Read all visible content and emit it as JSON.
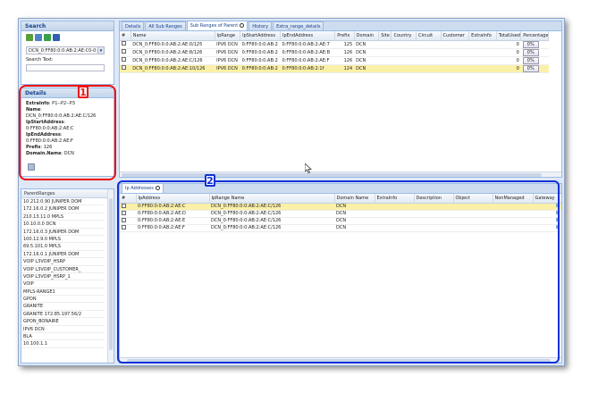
{
  "search_panel": {
    "title": "Search",
    "combo_value": "DCN_0:FF80:0:0:AB:2:AE:C0-0:F:",
    "search_text_label": "Search Text:"
  },
  "details_panel": {
    "title": "Details",
    "lines": [
      {
        "label": "ExtraInfo",
        "value": ": P1--P2--P3"
      },
      {
        "label": "Name",
        "value": ":"
      },
      {
        "label": "",
        "value": "DCN_0:FF80:0:0:AB:2:AE:C/126"
      },
      {
        "label": "IpStartAddress",
        "value": ":"
      },
      {
        "label": "",
        "value": "0:FF80:0:0:AB:2:AE:C"
      },
      {
        "label": "IpEndAddress",
        "value": ":"
      },
      {
        "label": "",
        "value": "0:FF80:0:0:AB:2:AE:F"
      },
      {
        "label": "Prefix",
        "value": ": 126"
      },
      {
        "label": "Domain.Name",
        "value": ": DCN"
      }
    ]
  },
  "parent_ranges": {
    "header": "ParentRanges",
    "items": [
      "10.212.0.90 JUNIPER DOM",
      "172.16.0.2 JUNIPER DOM",
      "210.13.11.0 MPLS",
      "10.10.0.0 DCN",
      "172.16.0.3 JUNIPER DOM",
      "100.12.9.0 MPLS",
      "69.5.101.0 MPLS",
      "172.16.0.1 JUNIPER DOM",
      "VOIP L3VOIP_HSRP",
      "VOIP L3VOIP_CUSTOMER_",
      "VOIP L3VOIP_HSRP_1",
      "VOIP",
      "MPLS-RANGE1",
      "GPON",
      "GRANITE",
      "GRANITE 172.85.197.56/2",
      "GPON_BONAIRE",
      "IPV6 DCN",
      "BLA",
      "10.100.1.1"
    ]
  },
  "top_tabs": [
    "Details",
    "All Sub Ranges",
    "Sub Ranges of Parent",
    "History",
    "Extra_range_details"
  ],
  "top_grid": {
    "columns": [
      "#",
      "Name",
      "IpRange",
      "IpStartAddress",
      "IpEndAddress",
      "Prefix",
      "Domain",
      "Site",
      "Country",
      "Circuit",
      "Customer",
      "ExtraInfo",
      "TotalUsed",
      "Percentage"
    ],
    "rows": [
      [
        "DCN_0:FF80:0:0:AB:2:AE:0/125",
        "IPV6 DCN",
        "0:FF80:0:0:AB:2",
        "0:FF80:0:0:AB:2:AE:7",
        "125",
        "DCN",
        "0",
        "0%"
      ],
      [
        "DCN_0:FF80:0:0:AB:2:AE:8/126",
        "IPV6 DCN",
        "0:FF80:0:0:AB:2",
        "0:FF80:0:0:AB:2:AE:B",
        "126",
        "DCN",
        "0",
        "0%"
      ],
      [
        "DCN_0:FF80:0:0:AB:2:AE:C/126",
        "IPV6 DCN",
        "0:FF80:0:0:AB:2",
        "0:FF80:0:0:AB:2:AE:F",
        "126",
        "DCN",
        "0",
        "0%"
      ],
      [
        "DCN_0:FF80:0:0:AB:2:AE:10/126",
        "IPV6 DCN",
        "0:FF80:0:0:AB:2",
        "0:FF80:0:0:AB:2:1f",
        "124",
        "DCN",
        "0",
        "0%"
      ]
    ],
    "selected_row": 3
  },
  "bottom_tab": "Ip Addresses",
  "bottom_grid": {
    "columns": [
      "#",
      "IpAddress",
      "IpRange Name",
      "Domain Name",
      "ExtraInfo",
      "Description",
      "Object",
      "NonManaged",
      "Gateway"
    ],
    "rows": [
      [
        "0:FF80:0:0:AB:2:AE:C",
        "DCN_0:FF80:0:0:AB:2:AE:C/126",
        "DCN"
      ],
      [
        "0:FF80:0:0:AB:2:AE:D",
        "DCN_0:FF80:0:0:AB:2:AE:C/126",
        "DCN"
      ],
      [
        "0:FF80:0:0:AB:2:AE:E",
        "DCN_0:FF80:0:0:AB:2:AE:C/126",
        "DCN"
      ],
      [
        "0:FF80:0:0:AB:2:AE:F",
        "DCN_0:FF80:0:0:AB:2:AE:C/126",
        "DCN"
      ]
    ],
    "selected_row": 0
  },
  "callouts": [
    "1",
    "2"
  ],
  "colors": {
    "callout_red": "#ee1111",
    "callout_blue": "#1131d8",
    "selected_row": "#fbf0a8"
  }
}
